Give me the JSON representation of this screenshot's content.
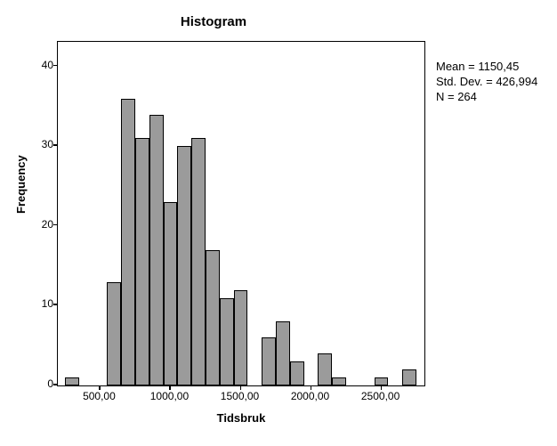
{
  "chart_data": {
    "type": "bar",
    "title": "Histogram",
    "xlabel": "Tidsbruk",
    "ylabel": "Frequency",
    "ylim": [
      0,
      43
    ],
    "xlim": [
      200,
      2800
    ],
    "x_ticks": [
      500,
      1000,
      1500,
      2000,
      2500
    ],
    "x_tick_labels": [
      "500,00",
      "1000,00",
      "1500,00",
      "2000,00",
      "2500,00"
    ],
    "y_ticks": [
      0,
      10,
      20,
      30,
      40
    ],
    "bin_width": 100,
    "bin_centers": [
      300,
      400,
      500,
      600,
      700,
      800,
      900,
      1000,
      1100,
      1200,
      1300,
      1400,
      1500,
      1600,
      1700,
      1800,
      1900,
      2000,
      2100,
      2200,
      2300,
      2400,
      2500,
      2600,
      2700
    ],
    "values": [
      1,
      0,
      0,
      13,
      36,
      31,
      34,
      23,
      30,
      31,
      17,
      11,
      12,
      0,
      6,
      8,
      3,
      0,
      4,
      1,
      0,
      0,
      1,
      0,
      2
    ],
    "stats": {
      "mean_label": "Mean = 1150,45",
      "std_label": "Std. Dev. = 426,994",
      "n_label": "N = 264"
    }
  }
}
